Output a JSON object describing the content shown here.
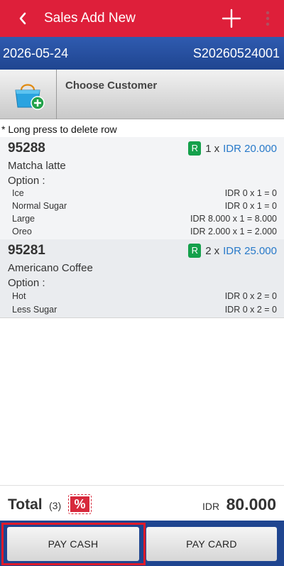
{
  "appbar": {
    "title": "Sales Add New",
    "back_icon": "chevron-left-icon",
    "add_icon": "plus-icon",
    "more_icon": "more-vertical-icon",
    "color": "#de1f3a"
  },
  "info": {
    "date": "2026-05-24",
    "doc_no": "S20260524001",
    "color": "#1f4590"
  },
  "customer": {
    "label": "Choose Customer",
    "icon": "shopping-bag-add-icon"
  },
  "hint": "* Long press to delete row",
  "items": [
    {
      "code": "95288",
      "badge": "R",
      "qty": "1",
      "x": "x",
      "price": "IDR 20.000",
      "name": "Matcha latte",
      "option_label": "Option :",
      "options": [
        {
          "name": "Ice",
          "value": "IDR 0 x 1 = 0"
        },
        {
          "name": "Normal Sugar",
          "value": "IDR 0 x 1 = 0"
        },
        {
          "name": "Large",
          "value": "IDR 8.000 x 1 = 8.000"
        },
        {
          "name": "Oreo",
          "value": "IDR 2.000 x 1 = 2.000"
        }
      ]
    },
    {
      "code": "95281",
      "badge": "R",
      "qty": "2",
      "x": "x",
      "price": "IDR 25.000",
      "name": "Americano Coffee",
      "option_label": "Option :",
      "options": [
        {
          "name": "Hot",
          "value": "IDR 0 x 2 = 0"
        },
        {
          "name": "Less Sugar",
          "value": "IDR 0 x 2 = 0"
        }
      ]
    }
  ],
  "total": {
    "label": "Total",
    "count": "(3)",
    "discount_symbol": "%",
    "currency": "IDR",
    "amount": "80.000"
  },
  "pay": {
    "cash_label": "PAY CASH",
    "card_label": "PAY CARD"
  }
}
